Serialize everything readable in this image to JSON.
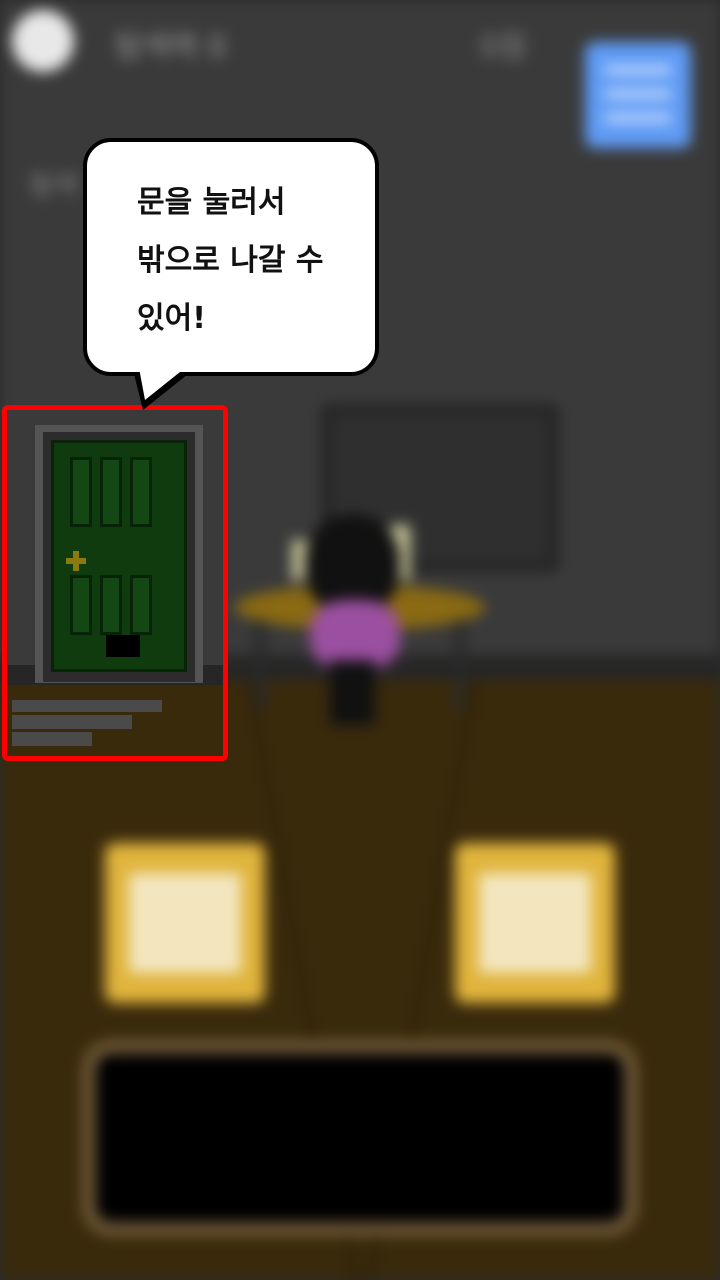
{
  "header": {
    "title": "탐색력 0",
    "counter": "0점",
    "menu_icon": "list-icon",
    "avatar_icon": "profile-avatar"
  },
  "sidebar": {
    "label": "탐색"
  },
  "hint": {
    "text": "문을 눌러서\n밖으로 나갈 수\n있어!"
  },
  "controls": {
    "left_icon": "envelope-icon",
    "right_icon": "envelope-icon"
  },
  "colors": {
    "highlight": "#ff0000",
    "door": "#0f3b0f",
    "menu_button": "#5f9bf5",
    "envelope_button": "#e0b43c"
  }
}
